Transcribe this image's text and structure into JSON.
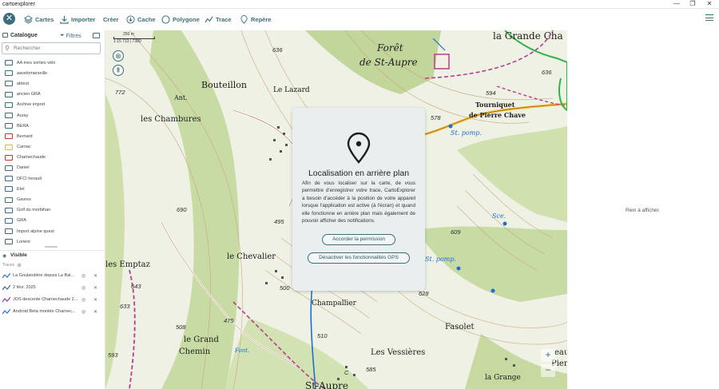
{
  "window": {
    "title": "cartoexplorer",
    "minimize": "—",
    "maximize": "❐",
    "close": "✕"
  },
  "toolbar": {
    "close_glyph": "✕",
    "items": [
      {
        "label": "Cartes",
        "icon": "layers-icon"
      },
      {
        "label": "Importer",
        "icon": "import-icon"
      },
      {
        "label": "Créer",
        "icon": ""
      },
      {
        "label": "Cache",
        "icon": "download-circle-icon"
      },
      {
        "label": "Polygone",
        "icon": "polygon-icon"
      },
      {
        "label": "Trace",
        "icon": "trace-icon"
      },
      {
        "label": "Repère",
        "icon": "marker-icon"
      }
    ],
    "accent": "#3b6d7c"
  },
  "catalogue": {
    "title": "Catalogue",
    "filters_label": "Filtres",
    "search_placeholder": "Rechercher",
    "items": [
      {
        "label": "AA mes sorties vélo",
        "color": "#3b6d7c"
      },
      {
        "label": "aavelomarseille",
        "color": "#3b6d7c"
      },
      {
        "label": "abtest",
        "color": "#3b6d7c"
      },
      {
        "label": "ancien GRA",
        "color": "#3b6d7c"
      },
      {
        "label": "Archive import",
        "color": "#3b6d7c"
      },
      {
        "label": "Auray",
        "color": "#3b6d7c"
      },
      {
        "label": "BERA",
        "color": "#3b6d7c"
      },
      {
        "label": "Bernard",
        "color": "#c0392b"
      },
      {
        "label": "Carnac",
        "color": "#e2b93b"
      },
      {
        "label": "Charnechaude",
        "color": "#c0392b"
      },
      {
        "label": "Daniel",
        "color": "#3b6d7c"
      },
      {
        "label": "DFCI herault",
        "color": "#3b6d7c"
      },
      {
        "label": "Etel",
        "color": "#3b6d7c"
      },
      {
        "label": "Gavres",
        "color": "#3b6d7c"
      },
      {
        "label": "Golf du morbihan",
        "color": "#3b6d7c"
      },
      {
        "label": "GRA",
        "color": "#3b6d7c"
      },
      {
        "label": "Import alpine quest",
        "color": "#3b6d7c"
      },
      {
        "label": "Lorient",
        "color": "#3b6d7c"
      }
    ]
  },
  "visible": {
    "title": "Visible",
    "traces_label": "Traces",
    "traces_count": "4",
    "traces": [
      {
        "name": "La Goulandière depuis La Bal...",
        "color": "#2b6ec9"
      },
      {
        "name": "2 févr. 2025",
        "color": "#3b6d7c"
      },
      {
        "name": "JOS descente Charnechaude 2...",
        "color": "#8e2fb8"
      },
      {
        "name": "Android Beta montée Charnec...",
        "color": "#2b6ec9"
      }
    ]
  },
  "map": {
    "scale_label": "250 m",
    "scale_ratio": "1:15 713 | 7380",
    "zoom_in": "+",
    "zoom_out": "−",
    "labels": [
      {
        "text": "Bouteillon",
        "size": 11
      },
      {
        "text": "Le Lazard",
        "size": 9
      },
      {
        "text": "Forêt",
        "size": 12
      },
      {
        "text": "de St-Aupre",
        "size": 12
      },
      {
        "text": "la Grande Cha",
        "size": 12
      },
      {
        "text": "Ant.",
        "size": 8
      },
      {
        "text": "les Chambures",
        "size": 10
      },
      {
        "text": "Tourniquet",
        "size": 8
      },
      {
        "text": "de Pierre Chave",
        "size": 8
      },
      {
        "text": "St. pomp.",
        "size": 8
      },
      {
        "text": "Sce.",
        "size": 8
      },
      {
        "text": "les Emptaz",
        "size": 10
      },
      {
        "text": "le Chevalier",
        "size": 10
      },
      {
        "text": "Champallier",
        "size": 9
      },
      {
        "text": "St. pomp.",
        "size": 8
      },
      {
        "text": "Fasolet",
        "size": 10
      },
      {
        "text": "le Grand",
        "size": 10
      },
      {
        "text": "Chemin",
        "size": 10
      },
      {
        "text": "Font.",
        "size": 7
      },
      {
        "text": "Les Vessières",
        "size": 10
      },
      {
        "text": "la Grange",
        "size": 9
      },
      {
        "text": "St-Aupre",
        "size": 12
      },
      {
        "text": "eau",
        "size": 10
      },
      {
        "text": "Pier",
        "size": 10
      }
    ],
    "elevations": [
      "636",
      "636",
      "772",
      "594",
      "578",
      "690",
      "495",
      "609",
      "643",
      "628",
      "500",
      "633",
      "475",
      "508",
      "510",
      "593",
      "585",
      "C"
    ]
  },
  "modal": {
    "title": "Localisation en arrière plan",
    "body": "Afin de vous localiser sur la carte, de vous permettre d'enregistrer votre trace, CartoExplorer a besoin d'accéder à la position de votre appareil lorsque l'application est active (à l'écran) et quand elle fonctionne en arrière plan mais également de pouvoir afficher des notifications.",
    "grant_button": "Accorder la permission",
    "disable_button": "Désactiver les fonctionnalités GPS"
  },
  "right_panel": {
    "empty_text": "Rien à afficher."
  }
}
